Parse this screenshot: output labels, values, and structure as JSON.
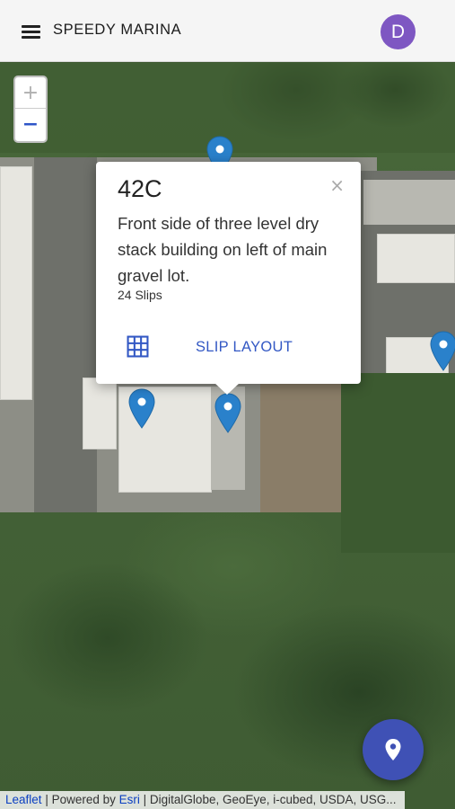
{
  "header": {
    "title": "SPEEDY MARINA",
    "avatar_letter": "D"
  },
  "map": {
    "zoom_in_label": "+",
    "zoom_out_label": "−"
  },
  "popup": {
    "title": "42C",
    "description": "Front side of three level dry stack building on left of main gravel lot.",
    "count_text": "24 Slips",
    "close_label": "×",
    "action_label": "SLIP LAYOUT"
  },
  "attribution": {
    "leaflet": "Leaflet",
    "powered_by": "Powered by",
    "esri": "Esri",
    "sources": "DigitalGlobe, GeoEye, i-cubed, USDA, USG..."
  },
  "colors": {
    "accent": "#3f51b5",
    "marker": "#2a81cb",
    "avatar": "#7e57c2",
    "link": "#3358c4"
  },
  "icons": {
    "menu": "menu-icon",
    "marker": "map-marker-icon",
    "grid": "grid-icon",
    "fab": "location-pin-icon"
  }
}
